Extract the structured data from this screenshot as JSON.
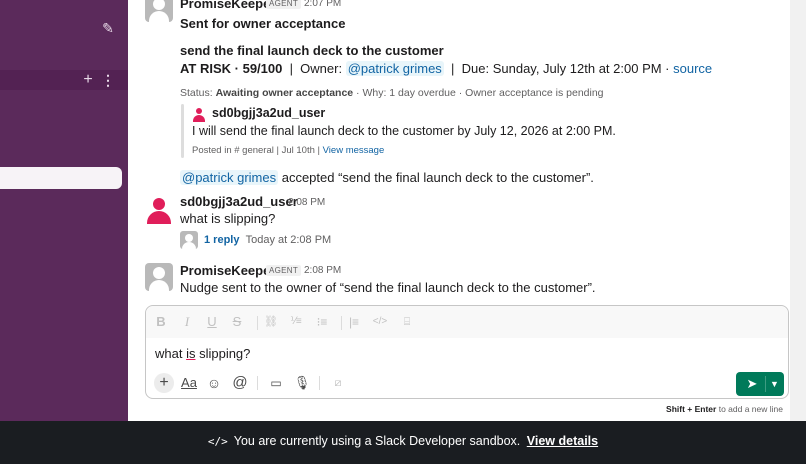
{
  "sidebar": {
    "compose_icon": "compose-icon",
    "section_add_icon": "+",
    "section_more_icon": "⋮"
  },
  "messages": {
    "m1": {
      "author": "PromiseKeeper",
      "badge": "AGENT",
      "time": "2:07 PM",
      "headline": "Sent for owner acceptance",
      "promise_title": "send the final launch deck to the customer",
      "risk": "AT RISK · 59/100",
      "owner_prefix": "  |  Owner: ",
      "owner_mention": "@patrick grimes",
      "due": "  |  Due: Sunday, July 12th at 2:00 PM · ",
      "source_link": "source",
      "status_prefix": "Status: ",
      "status_value": "Awaiting owner acceptance",
      "status_rest": " · Why: 1 day overdue · Owner acceptance is pending",
      "quote_user": "sd0bgjj3a2ud_user",
      "quote_text": "I will send the final launch deck to the customer by July 12, 2026 at 2:00 PM.",
      "quote_meta": "Posted in # general | Jul 10th | ",
      "quote_link": "View message",
      "accept_mention": "@patrick grimes",
      "accept_text": " accepted “send the final launch deck to the customer”."
    },
    "m2": {
      "author": "sd0bgjj3a2ud_user",
      "time": "2:08 PM",
      "text": "what is slipping?",
      "reply_link": "1 reply",
      "reply_time": "Today at 2:08 PM"
    },
    "m3": {
      "author": "PromiseKeeper",
      "badge": "AGENT",
      "time": "2:08 PM",
      "text": "Nudge sent to the owner of “send the final launch deck to the customer”."
    }
  },
  "composer": {
    "text_before": "what ",
    "text_underlined": "is",
    "text_after": " slipping?",
    "format_buttons": [
      "B",
      "I",
      "U",
      "S",
      "🔗",
      "1≡",
      "•≡",
      "▌≡",
      "</>",
      "⌨"
    ],
    "hint_key": "Shift + Enter",
    "hint_text": " to add a new line"
  },
  "banner": {
    "icon": "</>",
    "text": "You are currently using a Slack Developer sandbox.",
    "link": "View details"
  },
  "colors": {
    "sidebar": "#5b2a5b",
    "accent_link": "#1264a3",
    "send_button": "#007a5a",
    "avatar_red": "#e01e5a",
    "banner_bg": "#1a1d21"
  }
}
